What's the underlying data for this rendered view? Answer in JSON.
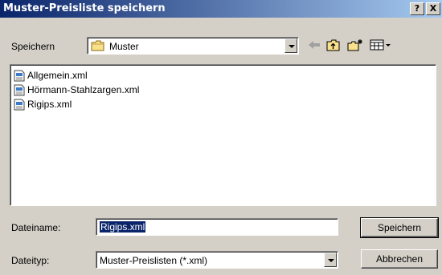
{
  "window": {
    "title": "Muster-Preisliste speichern",
    "help_button": "?",
    "close_button": "X"
  },
  "save_in": {
    "label": "Speichern",
    "value": "Muster"
  },
  "toolbar": {
    "icons": [
      "back-arrow-icon",
      "up-folder-icon",
      "new-folder-icon",
      "view-menu-icon"
    ]
  },
  "files": [
    {
      "name": "Allgemein.xml",
      "icon": "xml-file-icon"
    },
    {
      "name": "Hörmann-Stahlzargen.xml",
      "icon": "xml-file-icon"
    },
    {
      "name": "Rigips.xml",
      "icon": "xml-file-icon"
    }
  ],
  "filename": {
    "label": "Dateiname:",
    "value": "Rigips.xml"
  },
  "filetype": {
    "label": "Dateityp:",
    "value": "Muster-Preislisten (*.xml)"
  },
  "buttons": {
    "save": "Speichern",
    "cancel": "Abbrechen"
  },
  "colors": {
    "titlebar_start": "#0a246a",
    "titlebar_end": "#a6caf0",
    "dialog_bg": "#d4d0c8",
    "selection": "#0a246a"
  }
}
